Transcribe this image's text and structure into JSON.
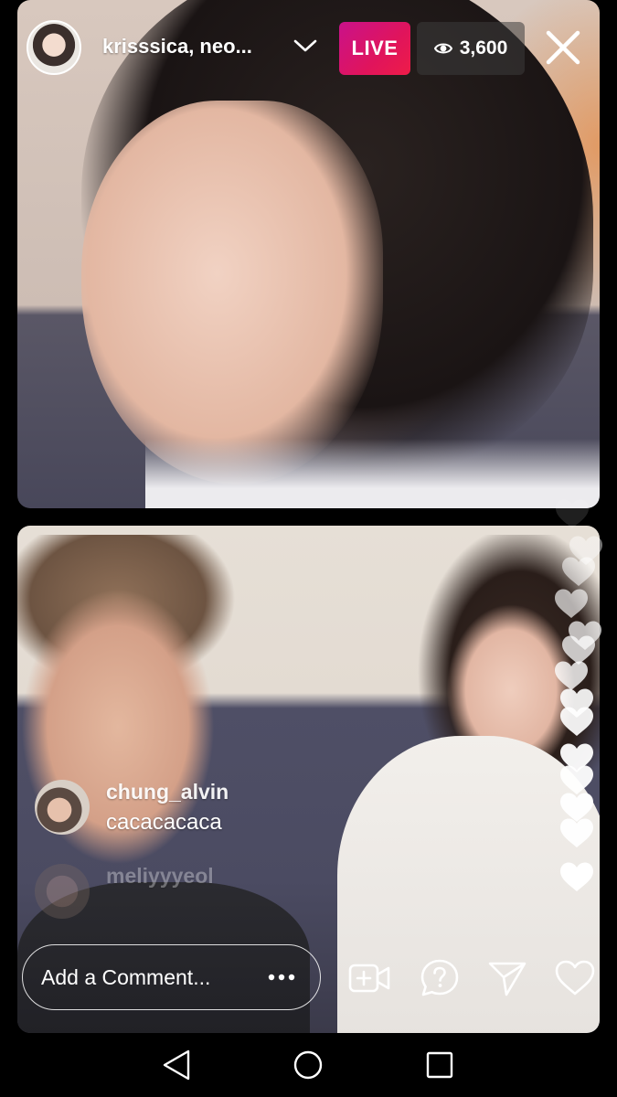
{
  "header": {
    "host_name": "krisssica, neo...",
    "live_label": "LIVE",
    "viewer_count": "3,600"
  },
  "comments": [
    {
      "username": "chung_alvin",
      "message": "cacacacaca"
    },
    {
      "username": "meliyyyeol",
      "message": ""
    }
  ],
  "composer": {
    "placeholder": "Add a Comment..."
  },
  "icons": {
    "avatar": "host-avatar",
    "chevron": "chevron-down-icon",
    "eye": "eye-icon",
    "close": "close-icon",
    "more": "more-icon",
    "add_video": "add-video-icon",
    "question": "question-icon",
    "send": "send-icon",
    "like": "heart-icon",
    "nav_back": "back-triangle-icon",
    "nav_home": "home-circle-icon",
    "nav_recents": "recents-square-icon"
  },
  "colors": {
    "live_gradient_start": "#c9128a",
    "live_gradient_end": "#ee1c48",
    "background": "#000000",
    "text": "#ffffff"
  }
}
